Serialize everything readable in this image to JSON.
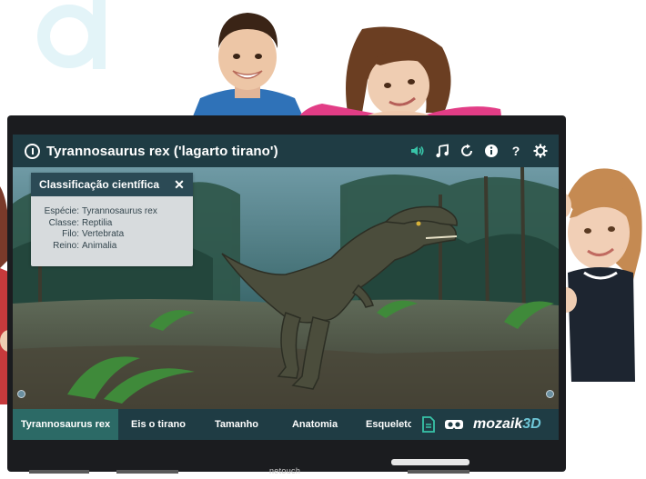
{
  "app": {
    "title": "Tyrannosaurus rex ('lagarto tirano')",
    "title_icon": "info-circle-icon",
    "toolbar_icons": [
      "sound-icon",
      "music-icon",
      "reset-icon",
      "info-icon",
      "help-icon",
      "settings-icon"
    ],
    "help_label": "?"
  },
  "popup": {
    "title": "Classificação científica",
    "close": "✕",
    "rows": [
      {
        "label": "Espécie:",
        "value": "Tyrannosaurus rex"
      },
      {
        "label": "Classe:",
        "value": "Reptilia"
      },
      {
        "label": "Filo:",
        "value": "Vertebrata"
      },
      {
        "label": "Reino:",
        "value": "Animalia"
      }
    ]
  },
  "tabs": [
    {
      "label": "Tyrannosaurus rex",
      "active": true
    },
    {
      "label": "Eis o tirano",
      "active": false
    },
    {
      "label": "Tamanho",
      "active": false
    },
    {
      "label": "Anatomia",
      "active": false
    },
    {
      "label": "Esqueleto",
      "active": false
    }
  ],
  "brand": {
    "name": "mozaik",
    "suffix": "3D"
  },
  "bottom_icons": [
    "document-icon",
    "vr-headset-icon"
  ],
  "bezel": {
    "logo": "netouch"
  },
  "colors": {
    "bar": "#1f3c44",
    "active_tab": "#2c6a66",
    "popup_bg": "#d7dbdd",
    "popup_head": "#2b4a55",
    "sound_accent": "#38c4a8",
    "brand_accent": "#6ec6d6"
  }
}
